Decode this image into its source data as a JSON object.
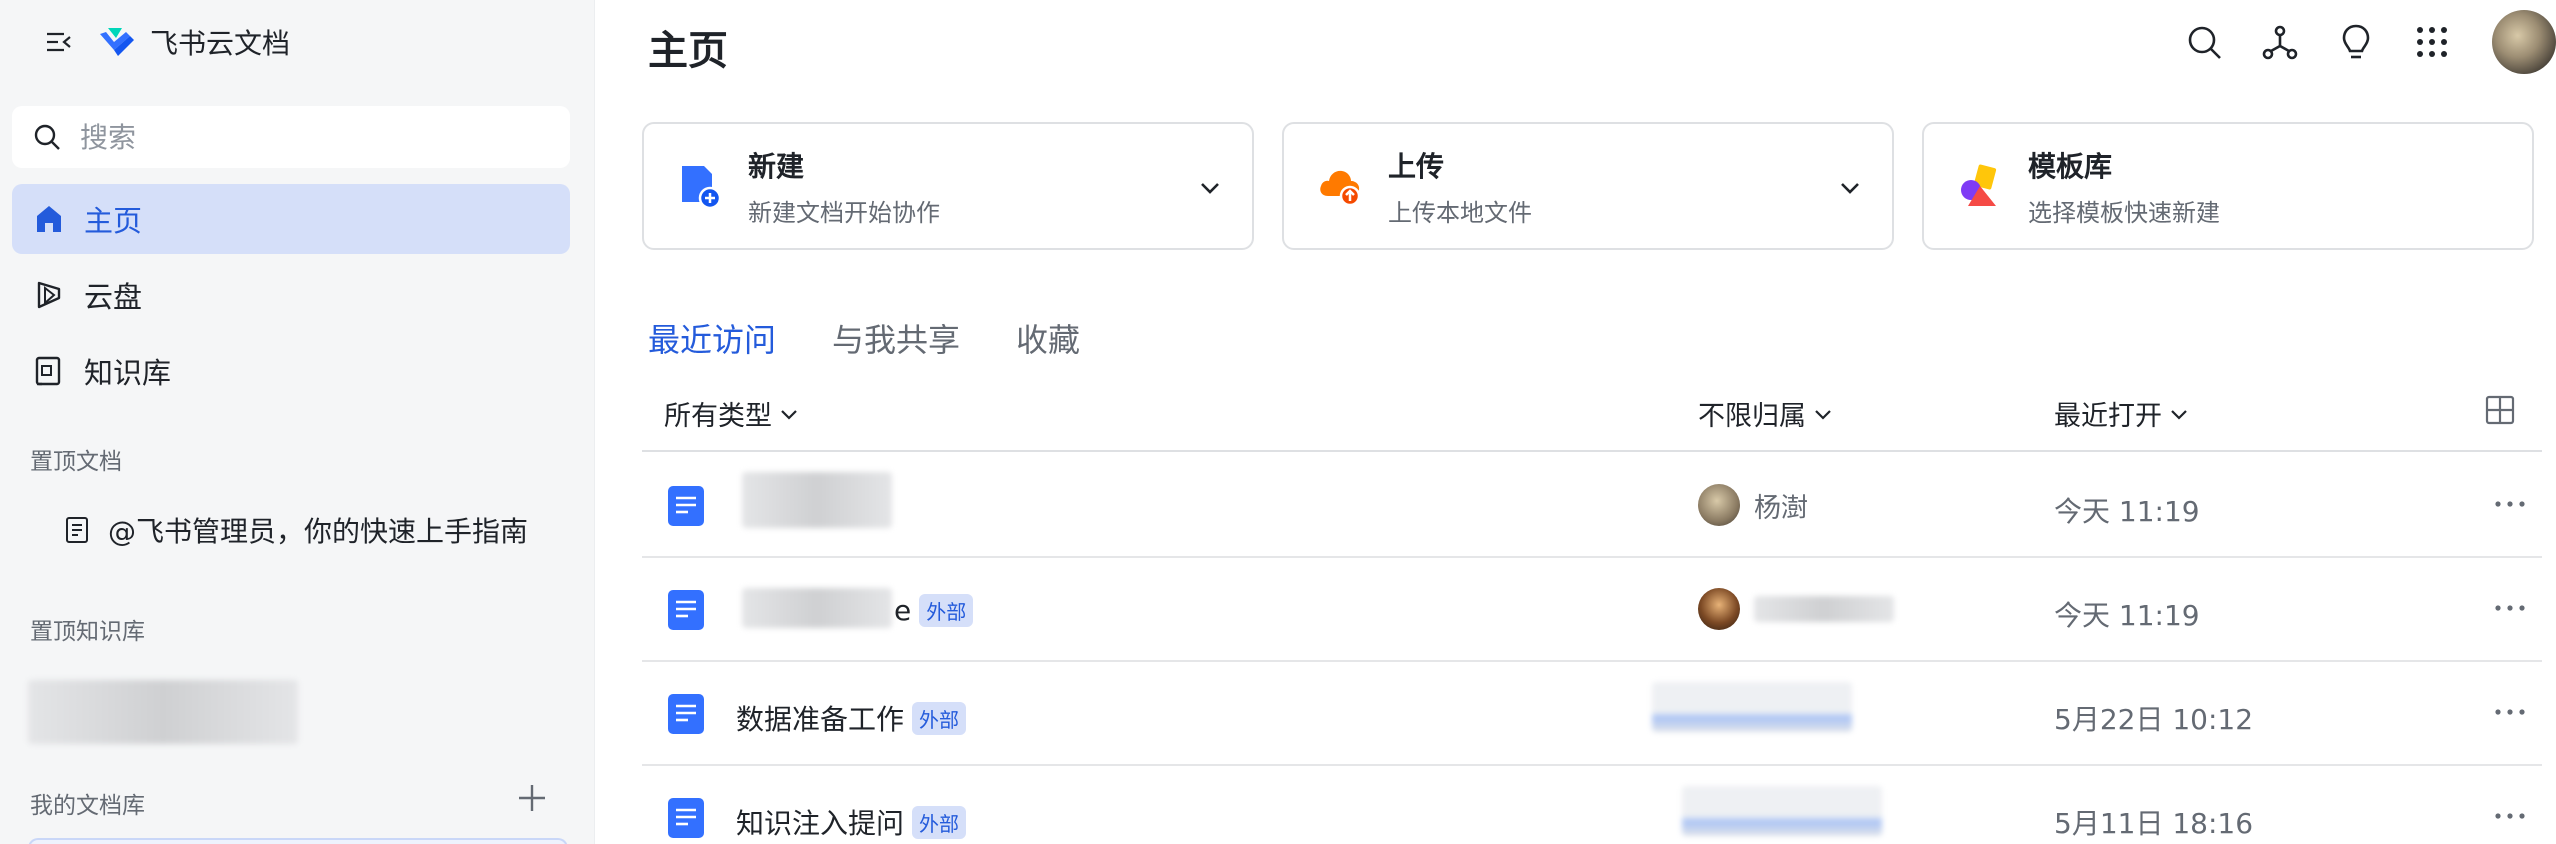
{
  "app": {
    "name": "飞书云文档"
  },
  "sidebar": {
    "search_placeholder": "搜索",
    "nav": [
      {
        "label": "主页",
        "icon": "home-icon",
        "active": true
      },
      {
        "label": "云盘",
        "icon": "cloud-drive-icon",
        "active": false
      },
      {
        "label": "知识库",
        "icon": "wiki-icon",
        "active": false
      }
    ],
    "pinned_docs_label": "置顶文档",
    "pinned_docs": [
      {
        "label": "@飞书管理员，你的快速上手指南",
        "icon": "doc-outline-icon"
      }
    ],
    "pinned_wiki_label": "置顶知识库",
    "my_library_label": "我的文档库"
  },
  "main": {
    "title": "主页",
    "cards": [
      {
        "title": "新建",
        "subtitle": "新建文档开始协作",
        "icon": "new-doc-icon",
        "has_dropdown": true
      },
      {
        "title": "上传",
        "subtitle": "上传本地文件",
        "icon": "upload-cloud-icon",
        "has_dropdown": true
      },
      {
        "title": "模板库",
        "subtitle": "选择模板快速新建",
        "icon": "template-icon",
        "has_dropdown": false
      }
    ],
    "tabs": [
      {
        "label": "最近访问",
        "active": true
      },
      {
        "label": "与我共享",
        "active": false
      },
      {
        "label": "收藏",
        "active": false
      }
    ],
    "filters": {
      "type": "所有类型",
      "owner": "不限归属",
      "sort": "最近打开"
    },
    "rows": [
      {
        "name": "",
        "badge": "",
        "owner": "杨澍",
        "time": "今天 11:19"
      },
      {
        "name": "e",
        "badge": "外部",
        "owner": "",
        "time": "今天 11:19"
      },
      {
        "name": "数据准备工作",
        "badge": "外部",
        "owner": "",
        "time": "5月22日 10:12"
      },
      {
        "name": "知识注入提问",
        "badge": "外部",
        "owner": "",
        "time": "5月11日 18:16"
      }
    ]
  },
  "colors": {
    "accent": "#245bdb",
    "active_bg": "#d5dff9",
    "sidebar_bg": "#f5f6f7"
  }
}
